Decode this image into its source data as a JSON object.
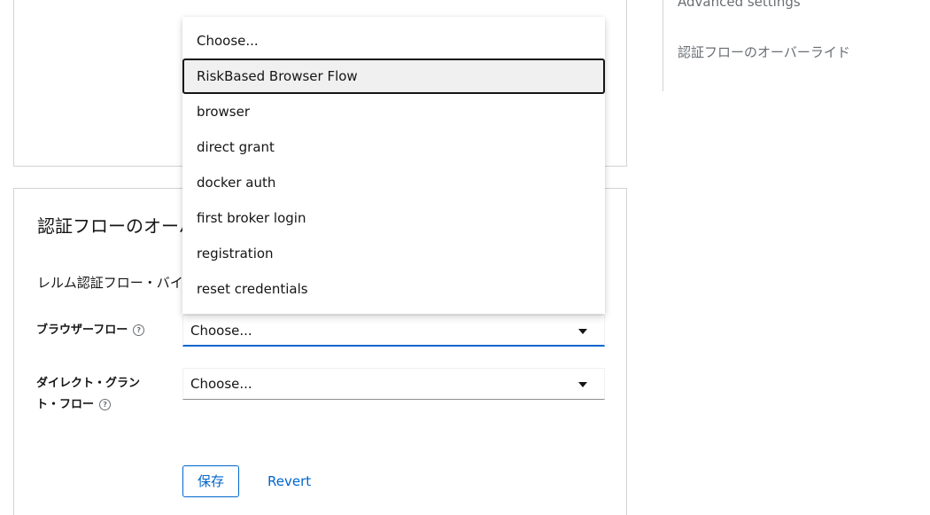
{
  "jump_nav": {
    "advanced_settings": "Advanced settings",
    "auth_flow_override": "認証フローのオーバーライド"
  },
  "section": {
    "title": "認証フローのオーバーライド",
    "subtitle": "レルム認証フロー・バインディングをオーバーライド"
  },
  "fields": {
    "browser_flow": {
      "label": "ブラウザーフロー",
      "value": "Choose..."
    },
    "direct_grant_flow": {
      "label_line1": "ダイレクト・グラン",
      "label_line2": "ト・フロー",
      "value": "Choose..."
    }
  },
  "dropdown": {
    "options": [
      "Choose...",
      "RiskBased Browser Flow",
      "browser",
      "direct grant",
      "docker auth",
      "first broker login",
      "registration",
      "reset credentials"
    ],
    "focused_option": "RiskBased Browser Flow"
  },
  "actions": {
    "save_label": "保存",
    "revert_label": "Revert"
  },
  "colors": {
    "accent": "#0066cc",
    "border": "#d2d2d2",
    "muted_text": "#6a6e73"
  }
}
